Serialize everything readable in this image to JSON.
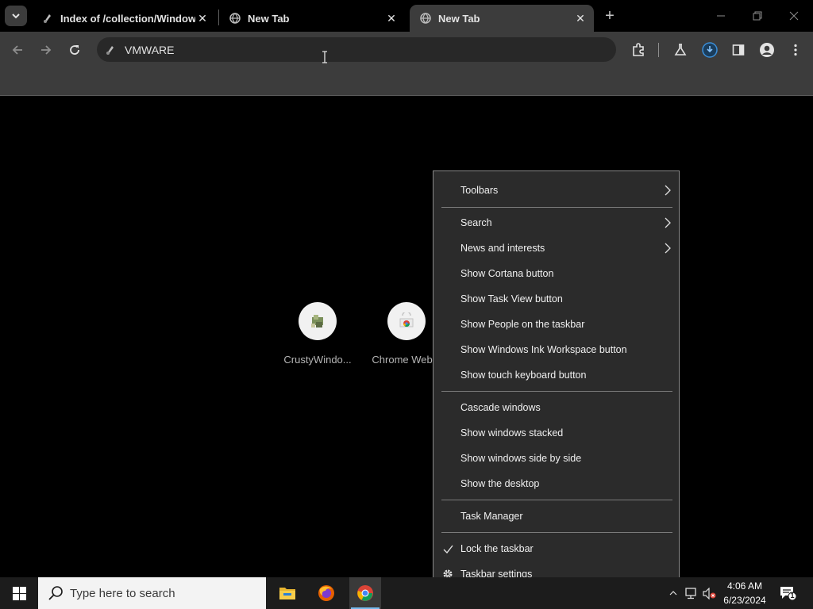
{
  "browser": {
    "tabs": [
      {
        "title": "Index of /collection/Windows",
        "active": false,
        "favicon": "site-icon"
      },
      {
        "title": "New Tab",
        "active": false,
        "favicon": "globe-icon"
      },
      {
        "title": "New Tab",
        "active": true,
        "favicon": "globe-icon"
      }
    ],
    "new_tab_symbol": "+",
    "omnibox": {
      "value": "VMWARE"
    },
    "toolbar_icons": [
      "back-icon",
      "forward-icon",
      "reload-icon",
      "extensions-icon",
      "labs-icon",
      "update-icon",
      "side-panel-icon",
      "profile-icon",
      "menu-icon"
    ]
  },
  "new_tab_page": {
    "shortcuts": [
      {
        "label": "CrustyWindo..."
      },
      {
        "label": "Chrome Web..."
      }
    ]
  },
  "context_menu": {
    "items": [
      {
        "label": "Toolbars",
        "submenu": true
      },
      {
        "label": "Search",
        "submenu": true
      },
      {
        "label": "News and interests",
        "submenu": true
      },
      {
        "label": "Show Cortana button"
      },
      {
        "label": "Show Task View button"
      },
      {
        "label": "Show People on the taskbar"
      },
      {
        "label": "Show Windows Ink Workspace button"
      },
      {
        "label": "Show touch keyboard button"
      },
      {
        "label": "Cascade windows"
      },
      {
        "label": "Show windows stacked"
      },
      {
        "label": "Show windows side by side"
      },
      {
        "label": "Show the desktop"
      },
      {
        "label": "Task Manager"
      },
      {
        "label": "Lock the taskbar",
        "checked": true
      },
      {
        "label": "Taskbar settings",
        "icon": "gear-icon"
      }
    ]
  },
  "taskbar": {
    "search_placeholder": "Type here to search",
    "apps": [
      "file-explorer-icon",
      "firefox-icon",
      "chrome-icon"
    ],
    "clock": {
      "time": "4:06 AM",
      "date": "6/23/2024"
    },
    "notification_count": "1"
  },
  "colors": {
    "accent": "#76b9ed",
    "menu_bg": "#2b2b2b",
    "toolbar_bg": "#3c3c3c"
  }
}
